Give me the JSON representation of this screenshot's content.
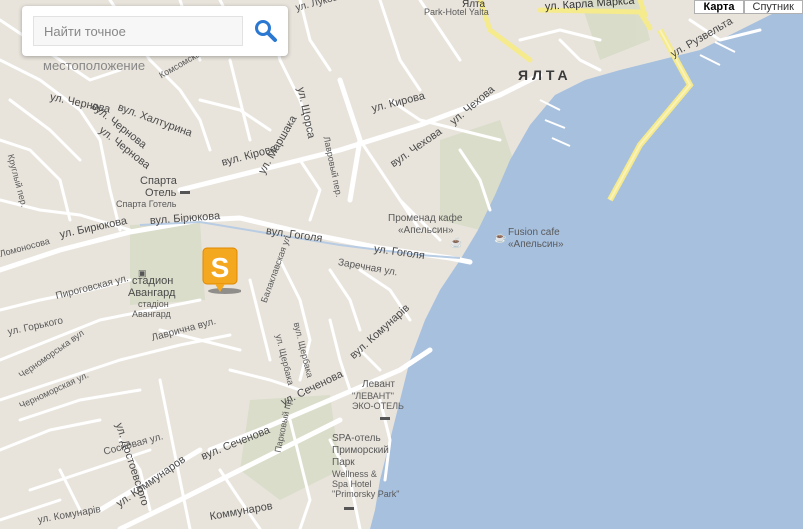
{
  "search": {
    "placeholder": "Найти точное",
    "placeholder_overflow": "местоположение"
  },
  "map_type": {
    "map_label": "Карта",
    "satellite_label": "Спутник",
    "active": "map"
  },
  "colors": {
    "land": "#e8e4dc",
    "water": "#a7c0de",
    "road": "#ffffff",
    "highway": "#f5ea8c",
    "green": "#d6ddc6",
    "marker": "#f4a820"
  },
  "labels": {
    "city": "ЯЛТА",
    "park_hotel": "Park-Hotel Yalta",
    "yalta_top": "Ялта",
    "karla_marksa": "ул. Карла Маркса",
    "ruzvelta": "ул. Рузвельта",
    "lukova": "ул. Лукова",
    "komsomolskaya": "Комсомская",
    "chernova_1": "ул. Чернова",
    "chernova_2": "вул. Чернова",
    "khalturina": "вул. Халтурина",
    "chernova_3": "ул. Чернова",
    "krugly_per": "Круглый пер.",
    "shorsa": "ул. Щорса",
    "kirova_ru": "ул. Кирова",
    "kirova_ua": "вул. Кірова",
    "lavrovy": "Лавровый пер.",
    "chekhova_ru": "ул. Чехова",
    "chekhova_ua": "вул. Чехова",
    "marshaka": "ул. Маршака",
    "sparta_ru": "Спарта",
    "sparta_ru2": "Отель",
    "sparta_ua": "Спарта Готель",
    "biryukova_ua": "вул. Бірюкова",
    "biryukova_ru": "ул. Бирюкова",
    "gogolya_ua": "вул. Гоголя",
    "gogolya_ru": "ул. Гоголя",
    "lomonosova": "Ломоносова",
    "promenad_1": "Променад кафе",
    "promenad_2": "«Апельсин»",
    "fusion_1": "Fusion cafe",
    "fusion_2": "«Апельсин»",
    "zarechnaya": "Заречная ул.",
    "stadion_1": "стадион",
    "stadion_2": "Авангард",
    "stadion_3": "стадіон",
    "stadion_4": "Авангард",
    "pirogovskaya": "Пироговская ул.",
    "gorkogo": "ул. Горького",
    "balaklavskaya": "Балаклавская ул.",
    "shcherbaka_ru": "ул. Щербака",
    "shcherbaka_ua": "вул. Щербака",
    "lavrichna": "Лаврична вул.",
    "chernomorskaya": "Черноморська вул",
    "chernomorskaya_ru": "Черноморская ул.",
    "kommunarov_ua": "вул. Комунарів",
    "kommunarov_ru": "ул. Коммунаров",
    "kommunarov_bottom": "Коммунаров",
    "dostoevskogo": "ул. Достоевского",
    "sosnovaya": "Сосновая ул.",
    "sechenova_ru": "ул. Сеченова",
    "sechenova_ua": "вул. Сеченова",
    "parkovy": "Парковый пр.",
    "levant_1": "Левант",
    "levant_2": "\"ЛЕВАНТ\"",
    "levant_3": "ЭКО-ОТЕЛЬ",
    "spa_1": "SPA-отель",
    "spa_2": "Приморский",
    "spa_3": "Парк",
    "spa_4": "Wellness &",
    "spa_5": "Spa Hotel",
    "spa_6": "\"Primorsky Park\"",
    "kommunariv_bottom": "ул. Комунарів",
    "ul_bottom": "ул."
  },
  "marker": {
    "letter": "S"
  }
}
